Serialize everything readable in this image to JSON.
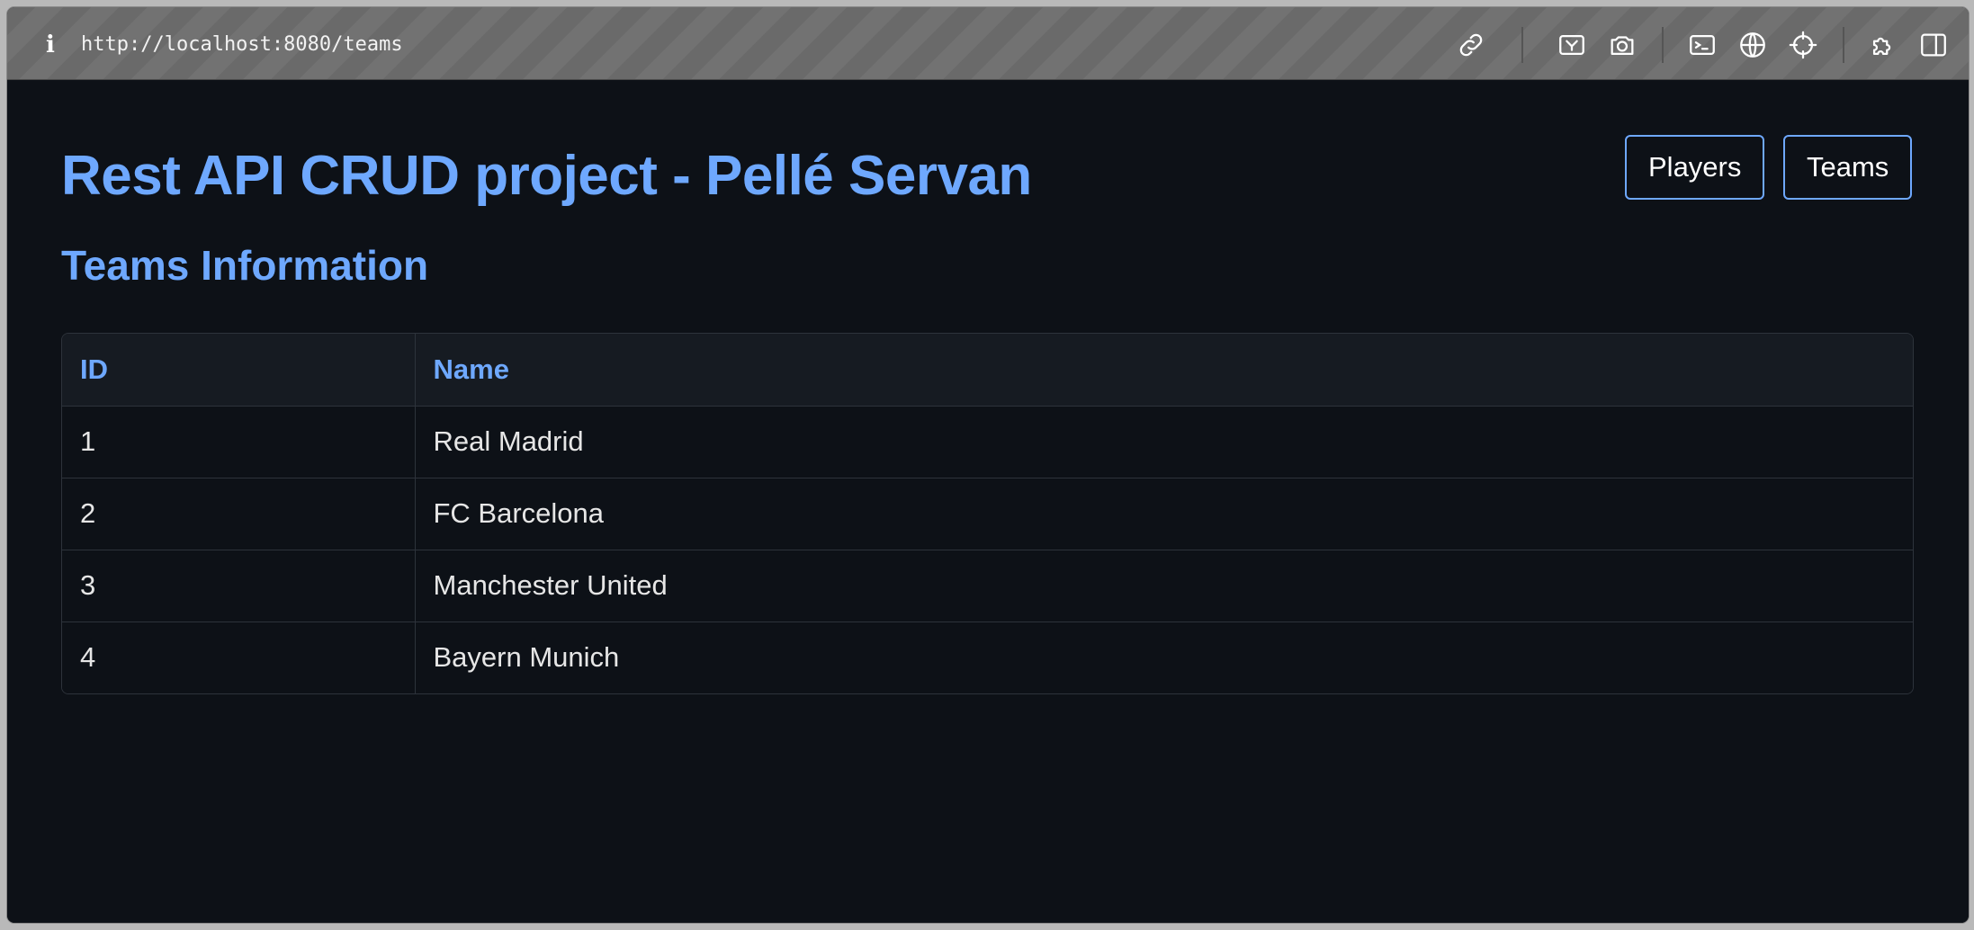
{
  "browser": {
    "url": "http://localhost:8080/teams",
    "info_glyph": "i",
    "icons": [
      "link-icon",
      "screencast-icon",
      "camera-icon",
      "terminal-icon",
      "globe-icon",
      "crosshair-icon",
      "extension-icon",
      "sidebar-icon"
    ]
  },
  "header": {
    "title": "Rest API CRUD project - Pellé Servan",
    "nav": {
      "players_label": "Players",
      "teams_label": "Teams"
    }
  },
  "section": {
    "title": "Teams Information"
  },
  "table": {
    "columns": [
      "ID",
      "Name"
    ],
    "rows": [
      {
        "id": "1",
        "name": "Real Madrid"
      },
      {
        "id": "2",
        "name": "FC Barcelona"
      },
      {
        "id": "3",
        "name": "Manchester United"
      },
      {
        "id": "4",
        "name": "Bayern Munich"
      }
    ]
  },
  "colors": {
    "accent": "#6ea8fe",
    "background": "#0d1117",
    "header_row": "#161b22"
  }
}
